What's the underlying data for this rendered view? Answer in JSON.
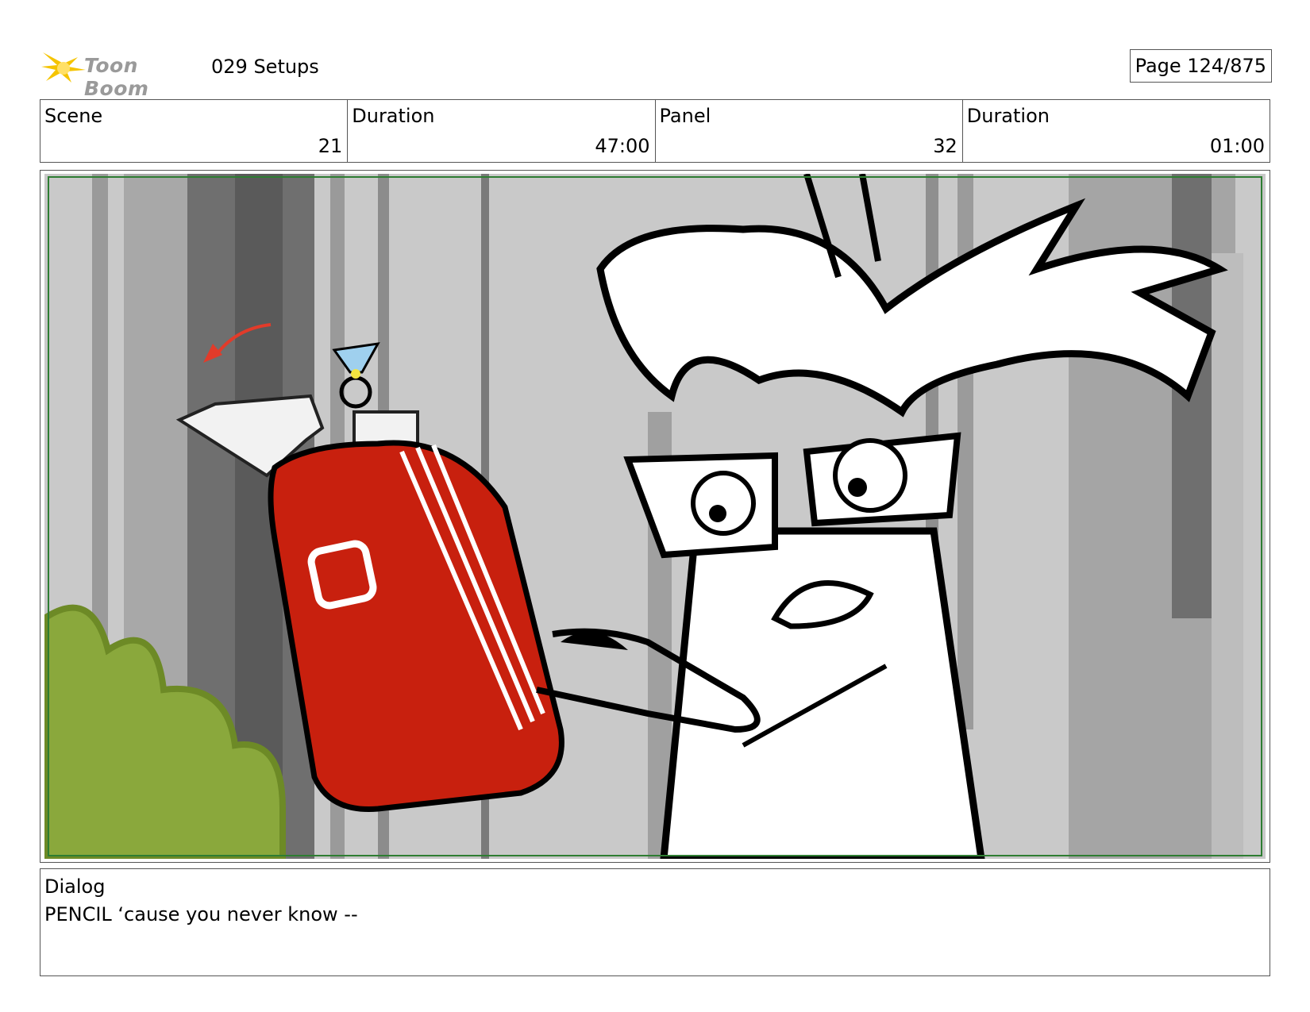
{
  "header": {
    "logo_text": "Toon Boom",
    "project_title": "029 Setups",
    "page_label": "Page 124/875"
  },
  "info": {
    "scene": {
      "label": "Scene",
      "value": "21"
    },
    "scene_duration": {
      "label": "Duration",
      "value": "47:00"
    },
    "panel": {
      "label": "Panel",
      "value": "32"
    },
    "panel_duration": {
      "label": "Duration",
      "value": "01:00"
    }
  },
  "dialog": {
    "label": "Dialog",
    "text": "PENCIL ‘cause you never know --"
  },
  "colors": {
    "frame_border": "#2e7d32",
    "sketchbook_red": "#c8200e",
    "bush_green": "#8aa83c"
  }
}
